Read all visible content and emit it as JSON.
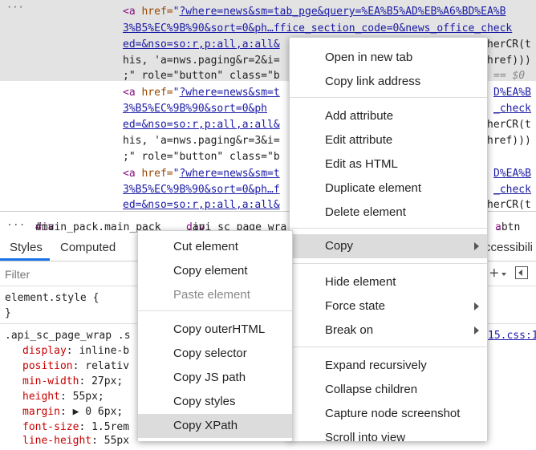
{
  "elements": {
    "dots": "···",
    "lines": [
      {
        "pre": "<a ",
        "attr": "href=",
        "q": "\"",
        "link": "?where=news&sm=tab_pge&query=%EA%B5%AD%EB%A6%BD%EA%B"
      },
      {
        "link": "3%B5%EC%9B%90&sort=0&ph…ffice_section_code=0&news_office_check"
      },
      {
        "link": "ed=&nso=so:r,p:all,a:all&",
        "tail": "herCR(t"
      },
      {
        "text": "his, 'a=nws.paging&r=2&i=",
        "tail": "href)))"
      },
      {
        "text": ";\" role=\"button\" class=\"b",
        "tail": "== $0"
      },
      {
        "pre": "<a ",
        "attr": "href=",
        "q": "\"",
        "link": "?where=news&sm=t",
        "tail": "D%EA%B"
      },
      {
        "link": "3%B5%EC%9B%90&sort=0&ph",
        "tail": "_check"
      },
      {
        "link": "ed=&nso=so:r,p:all,a:all&",
        "tail": "herCR(t"
      },
      {
        "text": "his, 'a=nws.paging&r=3&i=",
        "tail": "href)))"
      },
      {
        "text": ";\" role=\"button\" class=\"b"
      },
      {
        "pre": "<a ",
        "attr": "href=",
        "q": "\"",
        "link": "?where=news&sm=t",
        "tail": "D%EA%B"
      },
      {
        "link": "3%B5%EC%9B%90&sort=0&ph…f",
        "tail": "_check"
      },
      {
        "link": "ed=&nso=so:r,p:all,a:all&",
        "tail": "herCR(t"
      }
    ]
  },
  "breadcrumb": {
    "dots": "...",
    "item1_tag": "div",
    "item1_rest": "#main_pack.main_pack",
    "item2_tag": "div",
    "item2_rest": ".api_sc_page_wra",
    "item3_tag": "a",
    "item3_rest": ".btn"
  },
  "tabs": {
    "styles": "Styles",
    "computed": "Computed",
    "accessibility": "ccessibili"
  },
  "filter": {
    "placeholder": "Filter"
  },
  "styles": {
    "element_style": "element.style {",
    "element_close": "}",
    "selector": ".api_sc_page_wrap .s",
    "source": "15.css:1",
    "props": [
      {
        "name": "display",
        "value": "inline-b"
      },
      {
        "name": "position",
        "value": "relativ"
      },
      {
        "name": "min-width",
        "value": "27px;"
      },
      {
        "name": "height",
        "value": "55px;"
      },
      {
        "name": "margin",
        "value": "▶ 0 6px;"
      },
      {
        "name": "font-size",
        "value": "1.5rem"
      },
      {
        "name": "line-height",
        "value": "55px"
      }
    ]
  },
  "main_menu": {
    "items": [
      "Open in new tab",
      "Copy link address",
      "Add attribute",
      "Edit attribute",
      "Edit as HTML",
      "Duplicate element",
      "Delete element",
      "Copy",
      "Hide element",
      "Force state",
      "Break on",
      "Expand recursively",
      "Collapse children",
      "Capture node screenshot",
      "Scroll into view"
    ]
  },
  "copy_menu": {
    "items": [
      "Cut element",
      "Copy element",
      "Paste element",
      "Copy outerHTML",
      "Copy selector",
      "Copy JS path",
      "Copy styles",
      "Copy XPath"
    ]
  },
  "colors": {
    "tag": "#881280",
    "attr": "#994500",
    "value": "#1a1aa6",
    "css_prop": "#c80000",
    "accent": "#1a73e8"
  }
}
